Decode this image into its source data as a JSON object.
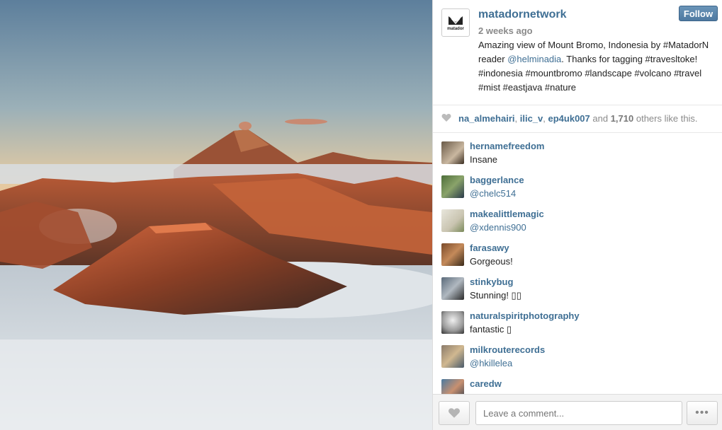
{
  "post": {
    "username": "matadornetwork",
    "logo_text": "matador",
    "time": "2 weeks ago",
    "follow_label": "Follow",
    "caption_before": "Amazing view of Mount Bromo, Indonesia by #MatadorN reader ",
    "caption_mention": "@helminadia",
    "caption_after": ". Thanks for tagging #travesltoke! #indonesia #mountbromo #landscape #volcano #travel #mist #eastjava #nature"
  },
  "likes": {
    "user1": "na_almehairi",
    "user2": "ilic_v",
    "user3": "ep4uk007",
    "and": " and ",
    "count": "1,710",
    "suffix": " others like this."
  },
  "comments": [
    {
      "user": "hernamefreedom",
      "text": "Insane",
      "mention": false
    },
    {
      "user": "baggerlance",
      "text": "@chelc514",
      "mention": true
    },
    {
      "user": "makealittlemagic",
      "text": "@xdennis900",
      "mention": true
    },
    {
      "user": "farasawy",
      "text": "Gorgeous!",
      "mention": false
    },
    {
      "user": "stinkybug",
      "text": "Stunning!    ▯▯",
      "mention": false
    },
    {
      "user": "naturalspiritphotography",
      "text": "fantastic ▯",
      "mention": false
    },
    {
      "user": "milkrouterecords",
      "text": "@hkillelea",
      "mention": true
    },
    {
      "user": "caredw",
      "text": "▯",
      "mention": false
    }
  ],
  "footer": {
    "comment_placeholder": "Leave a comment...",
    "more_label": "•••"
  },
  "colors": {
    "link": "#3f6f94",
    "follow_button": "#5581a8"
  }
}
